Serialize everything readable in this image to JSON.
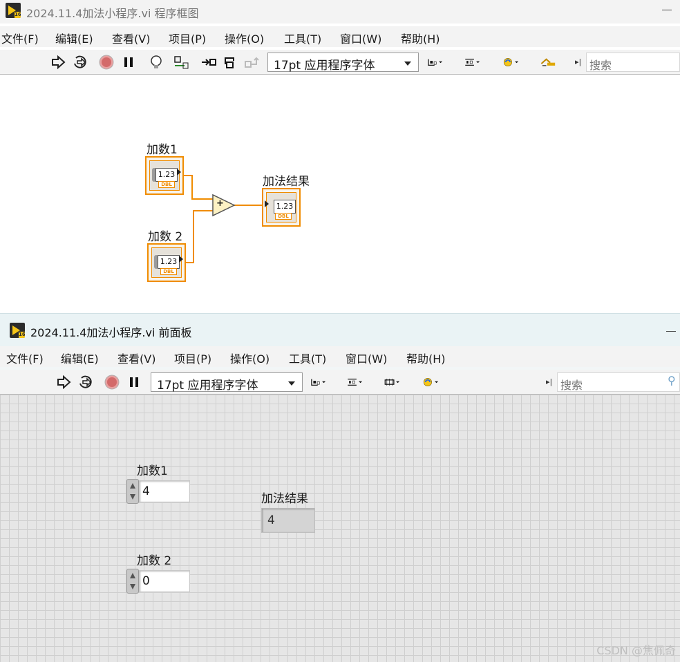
{
  "diagram_window": {
    "title": "2024.11.4加法小程序.vi 程序框图",
    "menu": [
      "文件(F)",
      "编辑(E)",
      "查看(V)",
      "项目(P)",
      "操作(O)",
      "工具(T)",
      "窗口(W)",
      "帮助(H)"
    ],
    "font_select": "17pt 应用程序字体",
    "search_placeholder": "搜索"
  },
  "diagram": {
    "input1_label": "加数1",
    "input2_label": "加数 2",
    "output_label": "加法结果",
    "terminal_value_text": "1.23",
    "terminal_type": "DBL",
    "add_symbol": "+"
  },
  "front_window": {
    "title": "2024.11.4加法小程序.vi 前面板",
    "menu": [
      "文件(F)",
      "编辑(E)",
      "查看(V)",
      "项目(P)",
      "操作(O)",
      "工具(T)",
      "窗口(W)",
      "帮助(H)"
    ],
    "font_select": "17pt 应用程序字体",
    "search_placeholder": "搜索"
  },
  "front_panel": {
    "input1_label": "加数1",
    "input1_value": "4",
    "input2_label": "加数 2",
    "input2_value": "0",
    "output_label": "加法结果",
    "output_value": "4"
  },
  "watermark": "CSDN @焦佩奇",
  "colors": {
    "wire_orange": "#f08c00",
    "grid_line": "#cfcfcf",
    "panel_bg": "#e6e6e6"
  }
}
